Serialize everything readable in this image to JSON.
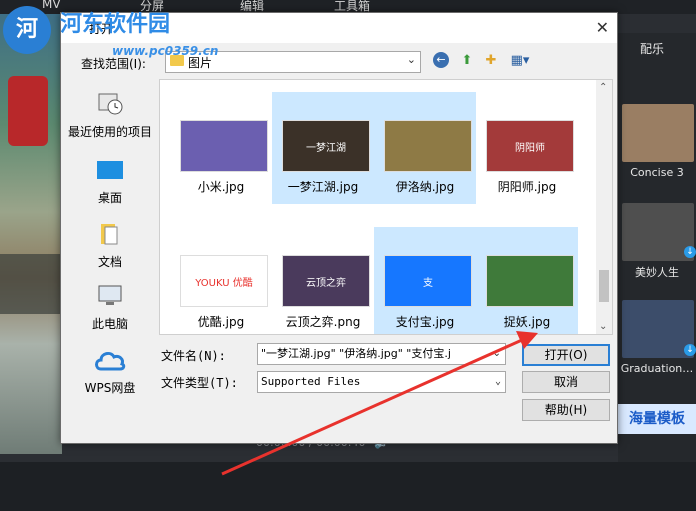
{
  "app": {
    "menu": [
      "MV",
      "分屏",
      "编辑",
      "工具箱"
    ],
    "right_tab": "配乐",
    "templates": [
      {
        "label": "Concise 3",
        "color": "#9a7e63"
      },
      {
        "label": "美妙人生",
        "color": "#4f4f4f"
      },
      {
        "label": "Graduation…",
        "color": "#3c4d6a"
      }
    ],
    "promo": "海量模板",
    "timecode": "00:00:00 / 00:00:40"
  },
  "watermark": {
    "title": "河东软件园",
    "url": "www.pc0359.cn"
  },
  "dialog": {
    "title": "打开",
    "lookin_label": "查找范围(I):",
    "lookin_value": "图片",
    "places": [
      {
        "label": "最近使用的项目",
        "icon": "recent-icon"
      },
      {
        "label": "桌面",
        "icon": "desktop-icon"
      },
      {
        "label": "文档",
        "icon": "documents-icon"
      },
      {
        "label": "此电脑",
        "icon": "computer-icon"
      },
      {
        "label": "WPS网盘",
        "icon": "cloud-icon"
      }
    ],
    "files": [
      {
        "name": "小米.jpg",
        "selected": false,
        "color": "#6b5fb0",
        "thumb_text": ""
      },
      {
        "name": "一梦江湖.jpg",
        "selected": true,
        "color": "#3b3128",
        "thumb_text": "一梦江湖"
      },
      {
        "name": "伊洛纳.jpg",
        "selected": true,
        "color": "#8e7a45",
        "thumb_text": ""
      },
      {
        "name": "阴阳师.jpg",
        "selected": false,
        "color": "#a33a3a",
        "thumb_text": "阴阳师"
      },
      {
        "name": "优酷.jpg",
        "selected": false,
        "color": "#ffffff",
        "thumb_text": "YOUKU 优酷"
      },
      {
        "name": "云顶之弈.png",
        "selected": false,
        "color": "#4a3a5c",
        "thumb_text": "云顶之弈"
      },
      {
        "name": "支付宝.jpg",
        "selected": true,
        "color": "#1677ff",
        "thumb_text": "支"
      },
      {
        "name": "捉妖.jpg",
        "selected": true,
        "color": "#3f7a3a",
        "thumb_text": ""
      }
    ],
    "filename_label": "文件名(N):",
    "filename_value": "\"一梦江湖.jpg\" \"伊洛纳.jpg\" \"支付宝.j",
    "filetype_label": "文件类型(T):",
    "filetype_value": "Supported Files",
    "open_button": "打开(O)",
    "cancel_button": "取消",
    "help_button": "帮助(H)"
  },
  "colors": {
    "accent": "#2a7fd4",
    "selection": "#cce8ff",
    "annotation_arrow": "#e8322d"
  }
}
